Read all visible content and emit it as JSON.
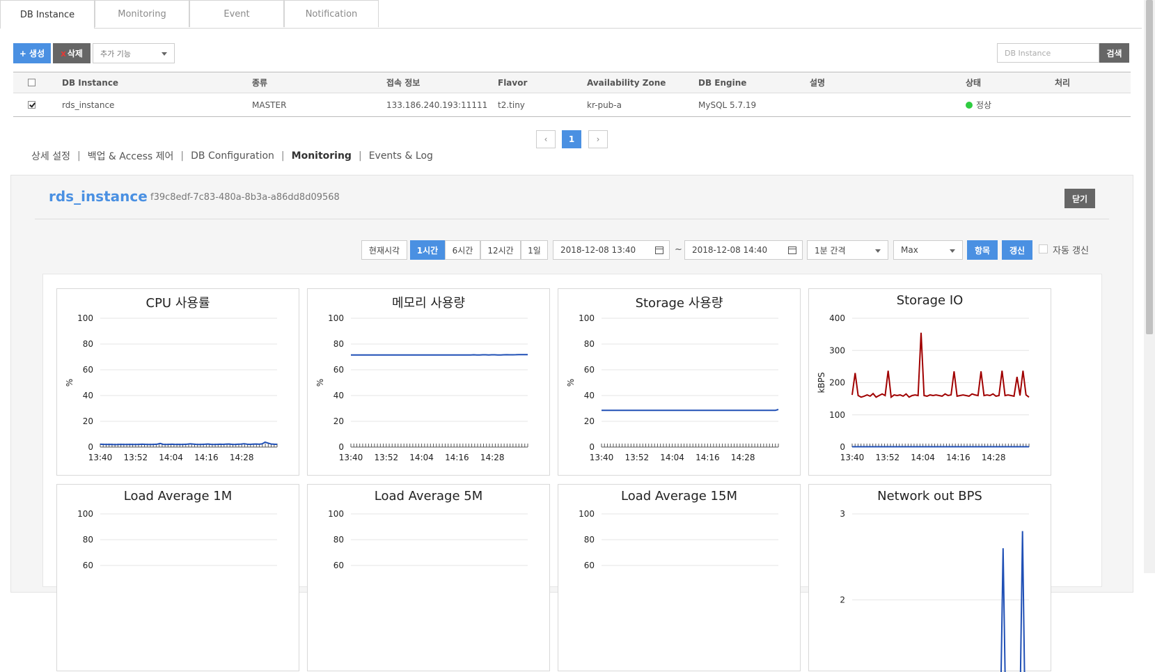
{
  "tabs": [
    "DB Instance",
    "Monitoring",
    "Event",
    "Notification"
  ],
  "toolbar": {
    "create_label": "+ 생성",
    "delete_x": "x",
    "delete_label": "삭제",
    "extra_select": "추가 기능",
    "search_placeholder": "DB Instance",
    "search_label": "검색"
  },
  "table": {
    "headers": [
      "DB Instance",
      "종류",
      "접속 정보",
      "Flavor",
      "Availability Zone",
      "DB Engine",
      "설명",
      "상태",
      "처리"
    ],
    "rows": [
      {
        "checked": true,
        "instance": "rds_instance",
        "type": "MASTER",
        "endpoint": "133.186.240.193:11111",
        "flavor": "t2.tiny",
        "az": "kr-pub-a",
        "engine": "MySQL 5.7.19",
        "description": "",
        "status": "정상",
        "status_color": "#2ecc40",
        "action": ""
      }
    ]
  },
  "pagination": {
    "prev": "‹",
    "current": "1",
    "next": "›"
  },
  "subtabs": [
    "상세 설정",
    "백업 & Access 제어",
    "DB Configuration",
    "Monitoring",
    "Events & Log"
  ],
  "subtab_active": "Monitoring",
  "detail": {
    "name": "rds_instance",
    "id": "f39c8edf-7c83-480a-8b3a-a86dd8d09568",
    "close_label": "닫기"
  },
  "controls": {
    "now_label": "현재시각",
    "ranges": [
      "1시간",
      "6시간",
      "12시간",
      "1일"
    ],
    "range_active": "1시간",
    "start": "2018-12-08 13:40",
    "tilde": "~",
    "end": "2018-12-08 14:40",
    "interval": "1분 간격",
    "aggregate": "Max",
    "items_label": "항목",
    "refresh_label": "갱신",
    "auto_refresh_label": "자동 갱신"
  },
  "colors": {
    "accent": "#4a90e2",
    "series_blue": "#1f4fb5",
    "series_red": "#a00000",
    "status_ok": "#2ecc40"
  },
  "chart_data": [
    {
      "type": "line",
      "title": "CPU 사용률",
      "ylabel": "%",
      "ylim": [
        0,
        100
      ],
      "yticks": [
        0,
        20,
        40,
        60,
        80,
        100
      ],
      "xticks": [
        "13:40",
        "13:52",
        "14:04",
        "14:16",
        "14:28"
      ],
      "series": [
        {
          "color": "#1f4fb5",
          "values": [
            2.2,
            2.1,
            2.0,
            2.1,
            2.0,
            1.9,
            2.0,
            2.1,
            2.0,
            2.0,
            2.1,
            2.0,
            2.0,
            2.1,
            2.2,
            2.1,
            2.0,
            2.0,
            2.1,
            2.2,
            2.8,
            2.1,
            2.0,
            2.1,
            2.2,
            2.0,
            2.1,
            2.0,
            2.1,
            2.2,
            2.5,
            2.3,
            2.1,
            2.0,
            2.1,
            2.2,
            2.4,
            2.1,
            2.0,
            2.1,
            2.2,
            2.1,
            2.3,
            2.4,
            2.1,
            2.0,
            2.2,
            2.3,
            2.6,
            2.2,
            2.1,
            2.3,
            2.4,
            2.2,
            2.5,
            3.8,
            3.1,
            2.4,
            2.2,
            2.1
          ]
        }
      ]
    },
    {
      "type": "line",
      "title": "메모리 사용량",
      "ylabel": "%",
      "ylim": [
        0,
        100
      ],
      "yticks": [
        0,
        20,
        40,
        60,
        80,
        100
      ],
      "xticks": [
        "13:40",
        "13:52",
        "14:04",
        "14:16",
        "14:28"
      ],
      "series": [
        {
          "color": "#1f4fb5",
          "values": [
            71.5,
            71.5,
            71.5,
            71.5,
            71.5,
            71.5,
            71.5,
            71.5,
            71.5,
            71.5,
            71.5,
            71.5,
            71.5,
            71.5,
            71.5,
            71.5,
            71.5,
            71.5,
            71.5,
            71.5,
            71.5,
            71.5,
            71.5,
            71.5,
            71.5,
            71.5,
            71.5,
            71.5,
            71.5,
            71.5,
            71.5,
            71.5,
            71.5,
            71.5,
            71.5,
            71.5,
            71.5,
            71.5,
            71.5,
            71.5,
            71.5,
            71.6,
            71.5,
            71.5,
            71.6,
            71.6,
            71.5,
            71.6,
            71.6,
            71.5,
            71.5,
            71.6,
            71.7,
            71.6,
            71.6,
            71.7,
            71.8,
            71.8,
            71.8,
            71.8
          ]
        }
      ]
    },
    {
      "type": "line",
      "title": "Storage 사용량",
      "ylabel": "%",
      "ylim": [
        0,
        100
      ],
      "yticks": [
        0,
        20,
        40,
        60,
        80,
        100
      ],
      "xticks": [
        "13:40",
        "13:52",
        "14:04",
        "14:16",
        "14:28"
      ],
      "series": [
        {
          "color": "#1f4fb5",
          "values": [
            28.5,
            28.5,
            28.5,
            28.5,
            28.5,
            28.5,
            28.5,
            28.5,
            28.5,
            28.5,
            28.5,
            28.5,
            28.5,
            28.5,
            28.5,
            28.5,
            28.5,
            28.5,
            28.5,
            28.5,
            28.5,
            28.5,
            28.5,
            28.5,
            28.5,
            28.5,
            28.5,
            28.5,
            28.5,
            28.5,
            28.5,
            28.5,
            28.5,
            28.5,
            28.5,
            28.5,
            28.5,
            28.5,
            28.5,
            28.5,
            28.5,
            28.5,
            28.5,
            28.5,
            28.5,
            28.5,
            28.5,
            28.5,
            28.5,
            28.5,
            28.5,
            28.5,
            28.5,
            28.5,
            28.5,
            28.5,
            28.5,
            28.5,
            28.5,
            29.2
          ]
        }
      ]
    },
    {
      "type": "line",
      "title": "Storage IO",
      "ylabel": "kBPS",
      "ylim": [
        0,
        400
      ],
      "yticks": [
        0,
        100,
        200,
        300,
        400
      ],
      "xticks": [
        "13:40",
        "13:52",
        "14:04",
        "14:16",
        "14:28"
      ],
      "series": [
        {
          "color": "#a00000",
          "values": [
            162,
            230,
            160,
            155,
            158,
            162,
            158,
            166,
            155,
            160,
            165,
            160,
            237,
            155,
            162,
            160,
            162,
            158,
            165,
            155,
            160,
            162,
            160,
            355,
            160,
            158,
            162,
            160,
            162,
            160,
            158,
            165,
            160,
            162,
            235,
            158,
            160,
            162,
            160,
            158,
            165,
            162,
            160,
            235,
            160,
            162,
            160,
            165,
            158,
            160,
            237,
            160,
            162,
            160,
            158,
            218,
            160,
            237,
            162,
            155
          ]
        },
        {
          "color": "#1f4fb5",
          "values": [
            1,
            1,
            1,
            1,
            1,
            1,
            1,
            1,
            1,
            1,
            1,
            1,
            1,
            1,
            1,
            1,
            1,
            1,
            1,
            1,
            1,
            1,
            1,
            1,
            1,
            1,
            1,
            1,
            1,
            1,
            1,
            1,
            1,
            1,
            1,
            1,
            1,
            1,
            1,
            1,
            1,
            1,
            1,
            1,
            1,
            1,
            1,
            1,
            1,
            1,
            1,
            1,
            1,
            1,
            1,
            1,
            1,
            1,
            1,
            1
          ]
        }
      ]
    },
    {
      "type": "line",
      "title": "Load Average 1M",
      "ylabel": "",
      "ylim": [
        0,
        100
      ],
      "yticks": [
        60,
        80,
        100
      ],
      "xticks": [],
      "series": []
    },
    {
      "type": "line",
      "title": "Load Average 5M",
      "ylabel": "",
      "ylim": [
        0,
        100
      ],
      "yticks": [
        60,
        80,
        100
      ],
      "xticks": [],
      "series": []
    },
    {
      "type": "line",
      "title": "Load Average 15M",
      "ylabel": "",
      "ylim": [
        0,
        100
      ],
      "yticks": [
        60,
        80,
        100
      ],
      "xticks": [],
      "series": []
    },
    {
      "type": "line",
      "title": "Network out BPS",
      "ylabel": "",
      "ylim": [
        1.5,
        3
      ],
      "yticks": [
        2,
        3
      ],
      "xticks": [],
      "series": [
        {
          "color": "#1f4fb5",
          "values": [
            0,
            0,
            0,
            0,
            0,
            0,
            0,
            0,
            0,
            0,
            0,
            0,
            0,
            0,
            0,
            0,
            0,
            0,
            0,
            0,
            0,
            0,
            0,
            0,
            0,
            0,
            0,
            0,
            0,
            0,
            0,
            0,
            0,
            0,
            0,
            0,
            0,
            0,
            0,
            0,
            0,
            0,
            0,
            0,
            0,
            0,
            0,
            0,
            0,
            0,
            0,
            0,
            0,
            0,
            0,
            0,
            0,
            0,
            0,
            0,
            0,
            0,
            0,
            0,
            0,
            0,
            0,
            0,
            0,
            0,
            2.6,
            0,
            0,
            0,
            0,
            0,
            0,
            0,
            0,
            2.8,
            0,
            0,
            0
          ]
        }
      ]
    }
  ]
}
